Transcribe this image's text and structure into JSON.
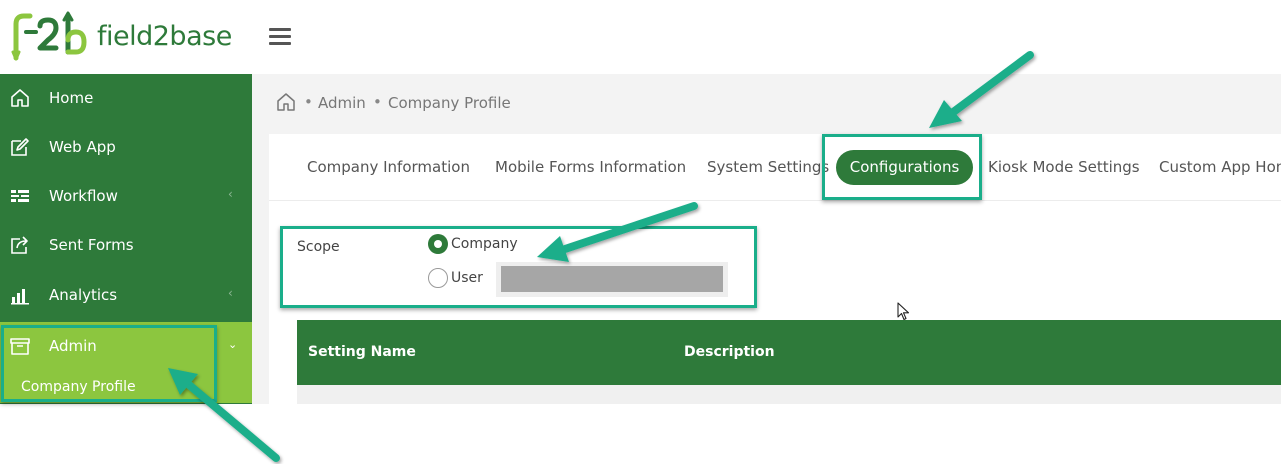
{
  "brand": {
    "logo_text": "field2base",
    "logo_icon": "f2b-logo-mark",
    "colors": {
      "primary_green": "#2e7a3a",
      "lime_green": "#8cc63f",
      "annotation_teal": "#1aae8a"
    }
  },
  "header": {
    "menu_icon": "hamburger-icon"
  },
  "sidebar": {
    "items": [
      {
        "label": "Home",
        "icon": "home-icon"
      },
      {
        "label": "Web App",
        "icon": "edit-icon"
      },
      {
        "label": "Workflow",
        "icon": "workflow-icon",
        "chevron": "‹"
      },
      {
        "label": "Sent Forms",
        "icon": "share-icon"
      },
      {
        "label": "Analytics",
        "icon": "bar-chart-icon",
        "chevron": "‹"
      },
      {
        "label": "Admin",
        "icon": "archive-box-icon",
        "chevron": "⌄"
      }
    ],
    "admin_subitem": "Company Profile"
  },
  "breadcrumb": {
    "sep": "•",
    "items": [
      "Admin",
      "Company Profile"
    ]
  },
  "tabs": [
    "Company Information",
    "Mobile Forms Information",
    "System Settings",
    "Configurations",
    "Kiosk Mode Settings",
    "Custom App Hom"
  ],
  "active_tab": "Configurations",
  "scope": {
    "label": "Scope",
    "options": [
      {
        "label": "Company",
        "selected": true
      },
      {
        "label": "User",
        "selected": false
      }
    ]
  },
  "table": {
    "columns": [
      "Setting Name",
      "Description"
    ]
  }
}
